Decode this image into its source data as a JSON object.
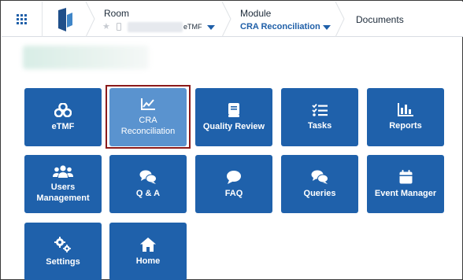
{
  "topbar": {
    "room_label": "Room",
    "room_tag": "eTMF",
    "module_label": "Module",
    "module_value": "CRA Reconciliation",
    "documents_label": "Documents"
  },
  "tiles": [
    {
      "label": "eTMF",
      "icon": "etmf-icon"
    },
    {
      "label": "CRA Reconciliation",
      "icon": "chart-line-icon",
      "active": true
    },
    {
      "label": "Quality Review",
      "icon": "book-icon"
    },
    {
      "label": "Tasks",
      "icon": "task-list-icon"
    },
    {
      "label": "Reports",
      "icon": "bar-chart-icon"
    },
    {
      "label": "Users Management",
      "icon": "users-icon"
    },
    {
      "label": "Q & A",
      "icon": "chat-bubbles-icon"
    },
    {
      "label": "FAQ",
      "icon": "chat-bubble-icon"
    },
    {
      "label": "Queries",
      "icon": "chat-bubbles-icon"
    },
    {
      "label": "Event Manager",
      "icon": "calendar-icon"
    },
    {
      "label": "Settings",
      "icon": "gears-icon"
    },
    {
      "label": "Home",
      "icon": "home-icon"
    }
  ],
  "colors": {
    "tile": "#1f61ab",
    "tile_active": "#5a93cf",
    "highlight_border": "#8b1a1a",
    "accent": "#1f5fa8"
  }
}
